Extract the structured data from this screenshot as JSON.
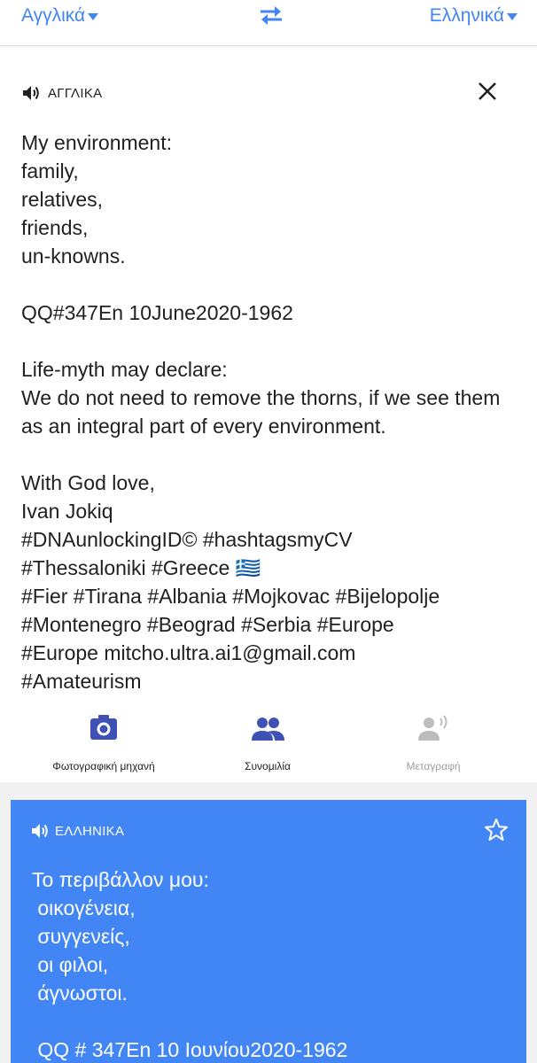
{
  "header": {
    "source_language": "Αγγλικά",
    "target_language": "Ελληνικά",
    "swap_icon": "swap-arrows-icon"
  },
  "source_card": {
    "language_label": "ΑΓΓΛΙΚΑ",
    "speaker_icon": "speaker-icon",
    "close_icon": "close-icon",
    "text": "My environment:\nfamily,\nrelatives,\nfriends,\nun-knowns.\n\nQQ#347En 10June2020-1962\n\nLife-myth may declare:\nWe do not need to remove the thorns, if we see them as an integral part of every environment.\n\nWith God love,\nIvan Jokiq\n#DNAunlockingID© #hashtagsmyCV\n#Thessaloniki #Greece 🇬🇷\n#Fier #Tirana #Albania #Mojkovac #Bijelopolje\n#Montenegro #Beograd #Serbia #Europe\n#Europe mitcho.ultra.ai1@gmail.com\n#Amateurism",
    "tools": [
      {
        "label": "Φωτογραφική μηχανή",
        "icon": "camera-icon",
        "enabled": true
      },
      {
        "label": "Συνομιλία",
        "icon": "conversation-icon",
        "enabled": true
      },
      {
        "label": "Μεταγραφή",
        "icon": "transcribe-icon",
        "enabled": false
      }
    ]
  },
  "target_card": {
    "language_label": "ΕΛΛΗΝΙΚΑ",
    "speaker_icon": "speaker-icon",
    "star_icon": "star-icon",
    "text": "Το περιβάλλον μου:\n οικογένεια,\n συγγενείς,\n οι φιλοι,\n άγνωστοι.\n\n QQ # 347En 10 Ιουνίου2020-1962"
  },
  "colors": {
    "accent": "#4285f4",
    "text": "#212121",
    "disabled": "#9e9e9e",
    "tool_icon": "#3f51b5"
  }
}
